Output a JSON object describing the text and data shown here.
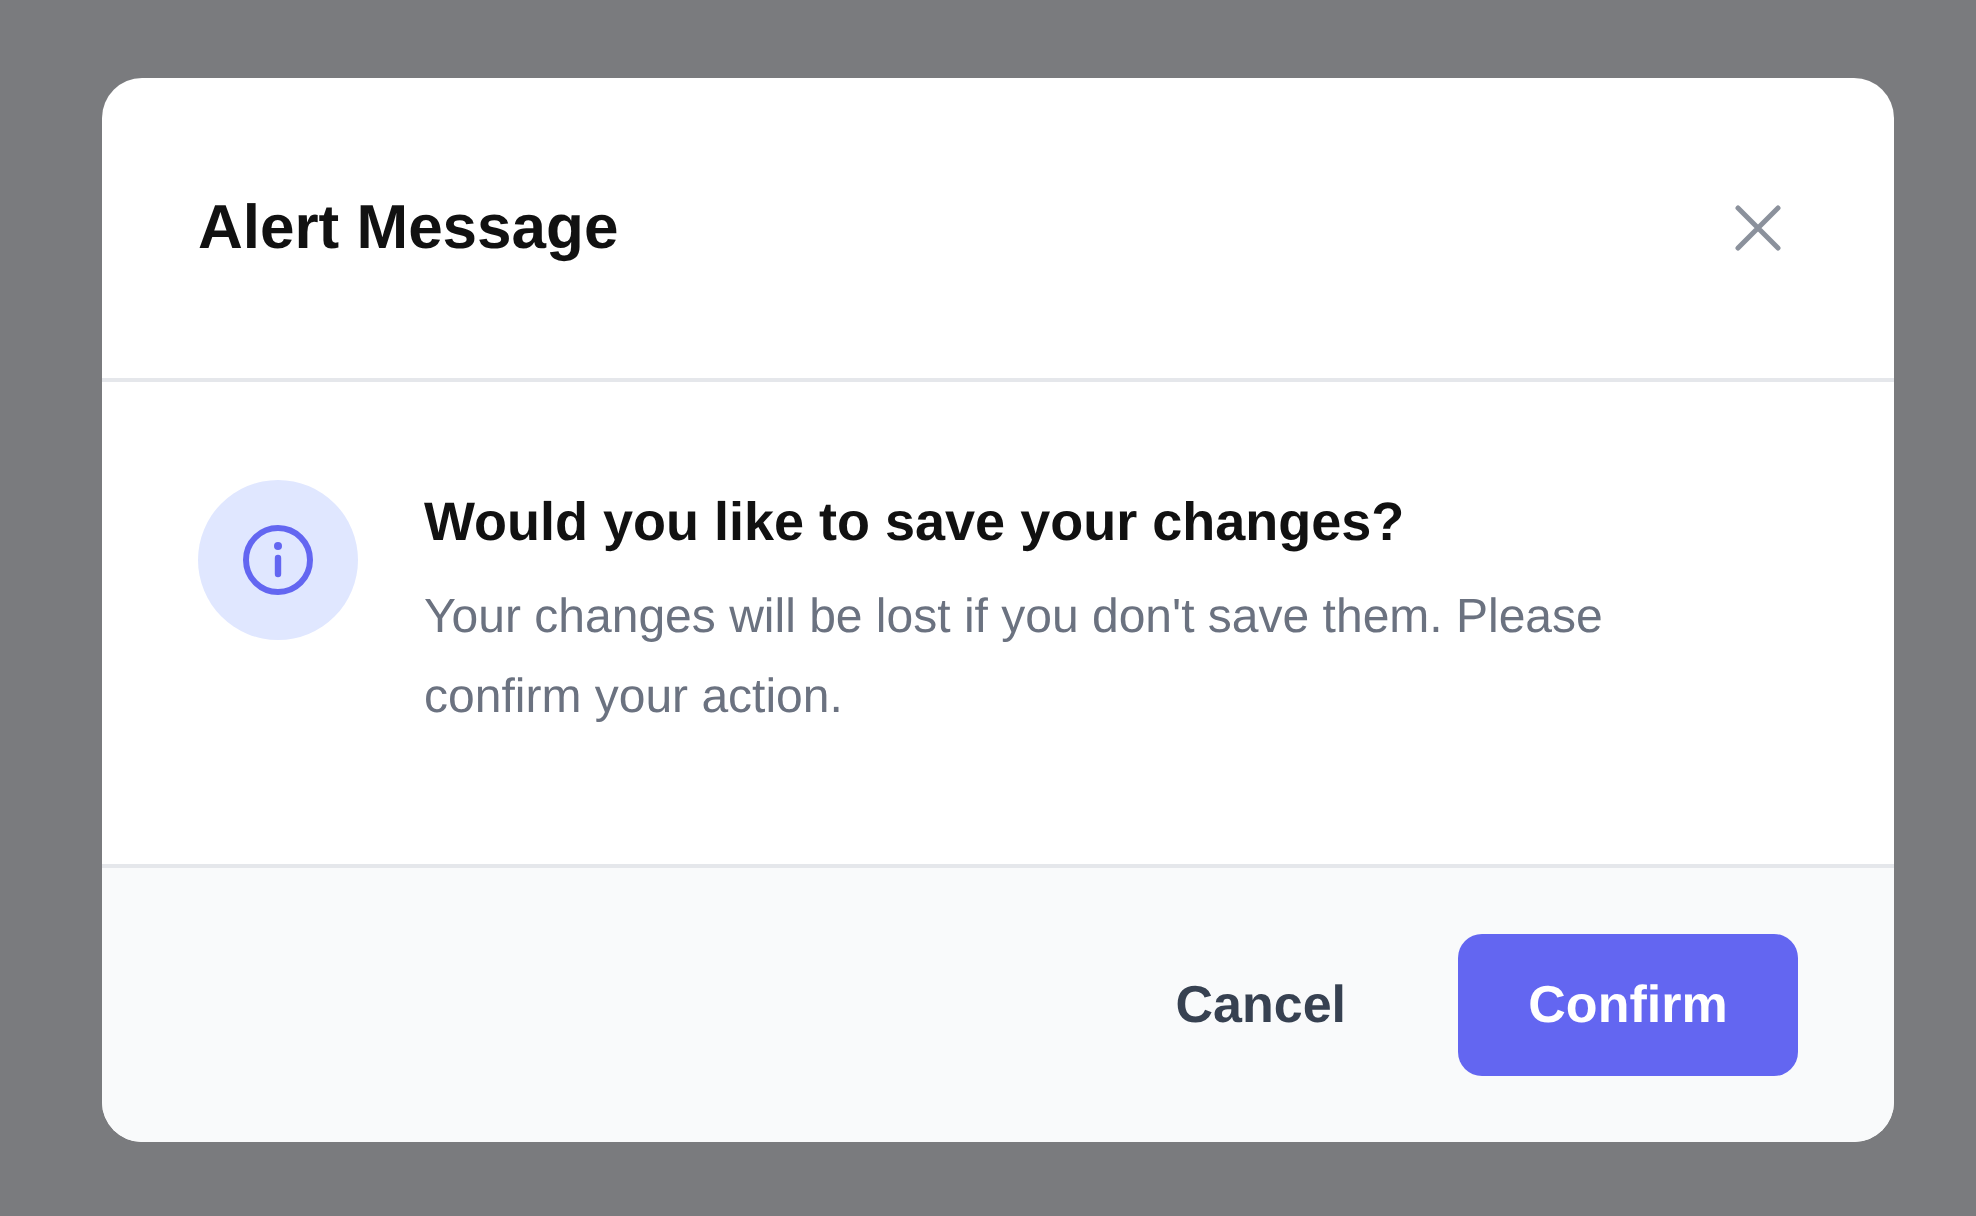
{
  "dialog": {
    "title": "Alert Message",
    "heading": "Would you like to save your changes?",
    "message": "Your changes will be lost if you don't save them. Please confirm your action.",
    "buttons": [
      {
        "label": "Cancel",
        "kind": "secondary"
      },
      {
        "label": "Confirm",
        "kind": "primary"
      }
    ]
  }
}
